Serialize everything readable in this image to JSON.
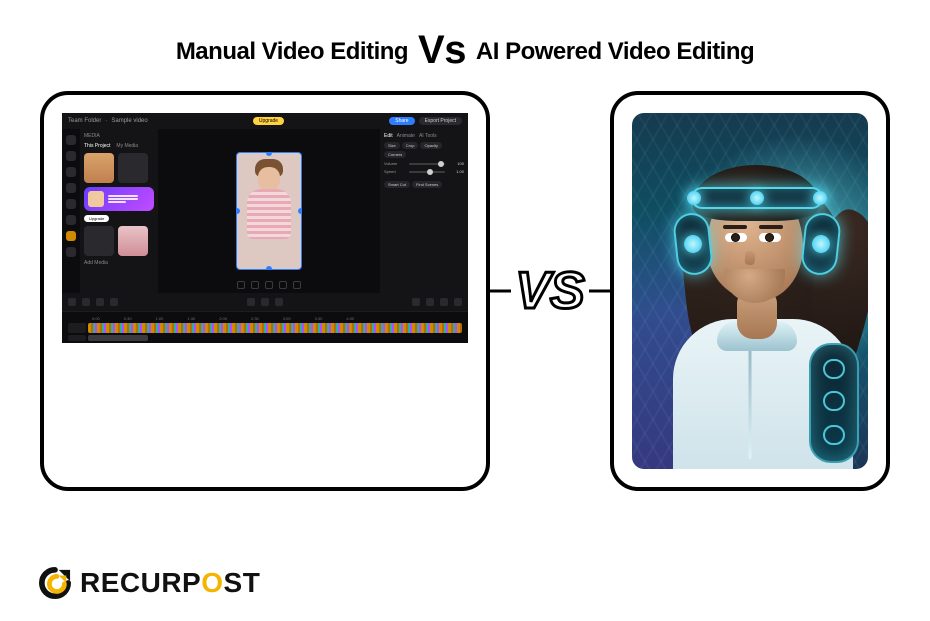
{
  "title": {
    "left": "Manual Video Editing",
    "vs": "Vs",
    "right": "AI Powered Video Editing"
  },
  "mid_vs": "VS",
  "brand": {
    "name_pre": "RECURP",
    "name_o": "O",
    "name_post": "ST"
  },
  "editor": {
    "topbar": {
      "crumb1": "Team Folder",
      "crumb2": "Sample video",
      "upgrade": "Upgrade",
      "share": "Share",
      "export": "Export Project"
    },
    "media": {
      "heading": "MEDIA",
      "tab1": "This Project",
      "tab2": "My Media",
      "promo_cta": "Upgrade",
      "add": "Add Media"
    },
    "inspector": {
      "tabs": [
        "Edit",
        "Animate",
        "AI Tools"
      ],
      "chips": [
        "Size",
        "Crop",
        "Opacity",
        "Corners"
      ],
      "sliders": [
        {
          "label": "Volume",
          "value": "100"
        },
        {
          "label": "Speed",
          "value": "1.00"
        }
      ],
      "big_chips": [
        "Smart Cut",
        "Find Scenes"
      ]
    },
    "timeline": {
      "marks": [
        "0:00",
        "0:30",
        "1:00",
        "1:30",
        "2:00",
        "2:30",
        "3:00",
        "3:30",
        "4:00"
      ]
    }
  }
}
